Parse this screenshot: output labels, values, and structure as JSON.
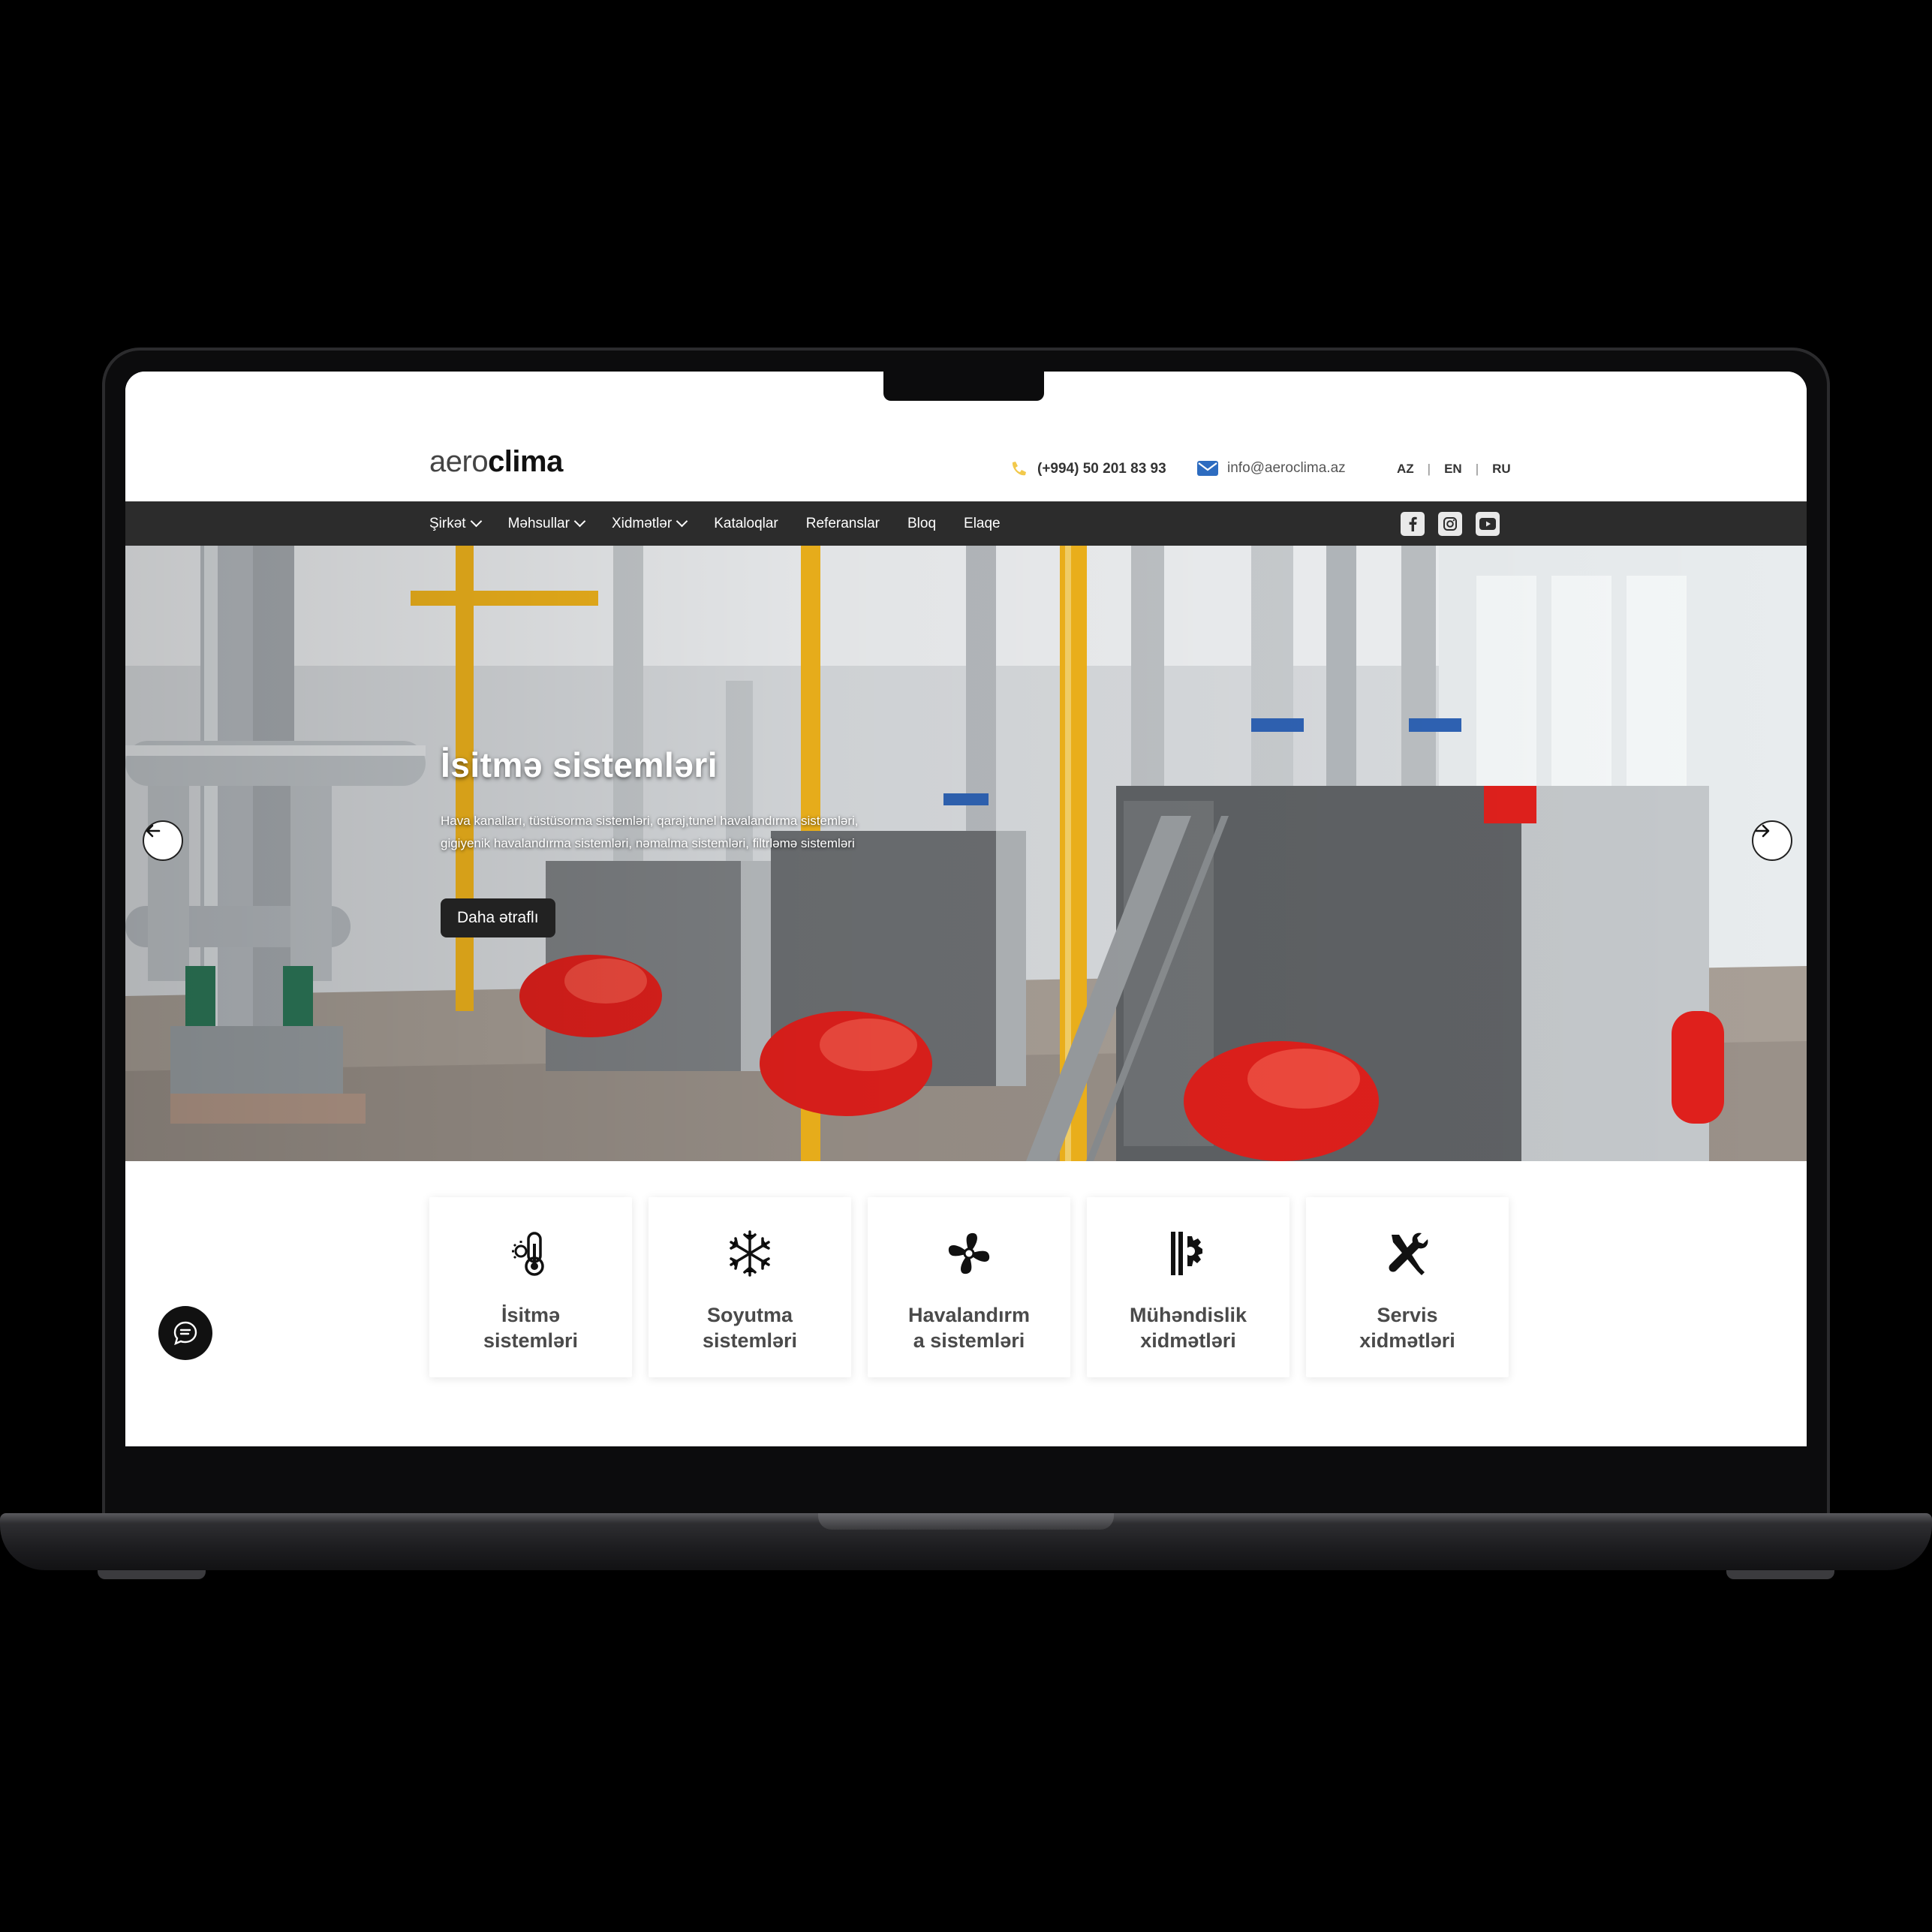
{
  "header": {
    "logo_light": "aero",
    "logo_bold": "clima",
    "phone": "(+994) 50 201 83 93",
    "email": "info@aeroclima.az",
    "languages": [
      "AZ",
      "EN",
      "RU"
    ]
  },
  "nav": {
    "items": [
      {
        "label": "Şirkət",
        "dropdown": true
      },
      {
        "label": "Məhsullar",
        "dropdown": true
      },
      {
        "label": "Xidmətlər",
        "dropdown": true
      },
      {
        "label": "Kataloqlar",
        "dropdown": false
      },
      {
        "label": "Referanslar",
        "dropdown": false
      },
      {
        "label": "Bloq",
        "dropdown": false
      },
      {
        "label": "Elaqe",
        "dropdown": false
      }
    ],
    "socials": [
      "facebook-icon",
      "instagram-icon",
      "youtube-icon"
    ]
  },
  "hero": {
    "title": "İsitmə sistemləri",
    "description": "Hava kanalları, tüstüsorma sistemləri, qaraj,tunel havalandırma sistemləri, gigiyenik havalandırma sistemləri, nəmalma sistemləri, filtrləmə sistemləri",
    "button": "Daha ətraflı"
  },
  "services": [
    {
      "label": "İsitmə\nsistemləri",
      "icon": "thermometer-icon"
    },
    {
      "label": "Soyutma\nsistemləri",
      "icon": "snowflake-icon"
    },
    {
      "label": "Havalandırm\na sistemləri",
      "icon": "fan-icon"
    },
    {
      "label": "Mühəndislik\nxidmətləri",
      "icon": "engineering-icon"
    },
    {
      "label": "Servis\nxidmətləri",
      "icon": "tools-icon"
    }
  ],
  "colors": {
    "nav_bg": "#2c2c2c",
    "phone_icon": "#f2c94c",
    "mail_icon": "#2d6cc0",
    "burner_red": "#e0201c",
    "pipe_yellow": "#f2b51c"
  }
}
